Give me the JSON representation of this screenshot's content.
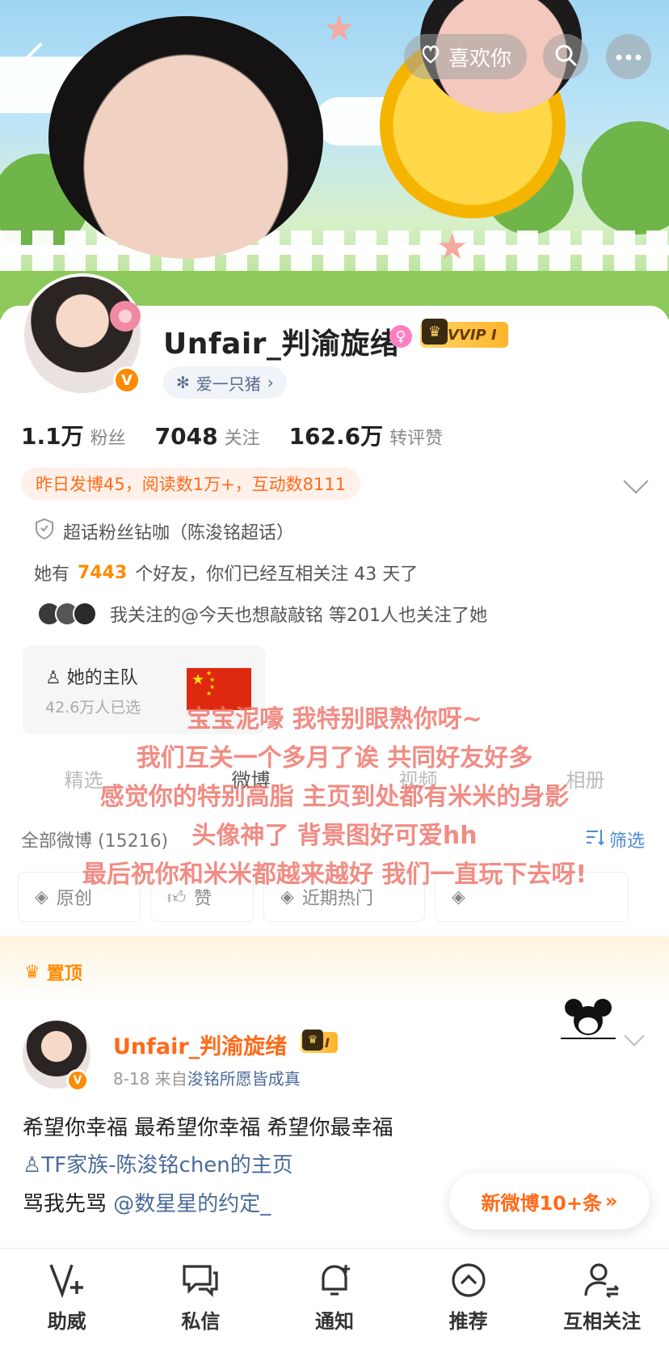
{
  "header": {
    "like_label": "喜欢你"
  },
  "profile": {
    "name": "Unfair_判渝旋绪",
    "vip_label": "VVIP I",
    "tag": "爱一只猪",
    "followers_num": "1.1万",
    "followers_label": "粉丝",
    "following_num": "7048",
    "following_label": "关注",
    "interactions_num": "162.6万",
    "interactions_label": "转评赞",
    "activity": "昨日发博45，阅读数1万+，互动数8111",
    "supertopic": "超话粉丝钻咖（陈浚铭超话）",
    "friends_prefix": "她有",
    "friends_count": "7443",
    "friends_suffix": "个好友，你们已经互相关注 43 天了",
    "mutual_follow": "我关注的@今天也想敲敲铭  等201人也关注了她",
    "team_title": "她的主队",
    "team_sub": "42.6万人已选"
  },
  "tabs": [
    {
      "label": "精选"
    },
    {
      "label": "微博"
    },
    {
      "label": "视频"
    },
    {
      "label": "相册"
    }
  ],
  "feed": {
    "all_label": "全部微博 (15216)",
    "filter_label": "筛选",
    "chips": [
      {
        "label": "原创"
      },
      {
        "label": "赞"
      },
      {
        "label": "近期热门"
      }
    ],
    "pinned_label": "置顶"
  },
  "post": {
    "name": "Unfair_判渝旋绪",
    "crown_label": "I",
    "date": "8-18",
    "source_prefix": "来自",
    "source": "浚铭所愿皆成真",
    "line1": "希望你幸福 最希望你幸福 希望你最幸福",
    "line2": "TF家族-陈浚铭chen的主页",
    "line3_prefix": "骂我先骂",
    "line3_mention": "@数星星的约定_"
  },
  "new_posts": "新微博10+条",
  "overlay_text": [
    "宝宝泥嚎 我特别眼熟你呀~",
    "我们互关一个多月了诶 共同好友好多",
    "感觉你的特别高脂 主页到处都有米米的身影",
    "头像神了 背景图好可爱hh",
    "最后祝你和米米都越来越好 我们一直玩下去呀!"
  ],
  "bottom_nav": [
    {
      "label": "助威",
      "icon": "cheer-icon"
    },
    {
      "label": "私信",
      "icon": "message-icon"
    },
    {
      "label": "通知",
      "icon": "bell-icon"
    },
    {
      "label": "推荐",
      "icon": "recommend-icon"
    },
    {
      "label": "互相关注",
      "icon": "mutual-follow-icon"
    }
  ]
}
